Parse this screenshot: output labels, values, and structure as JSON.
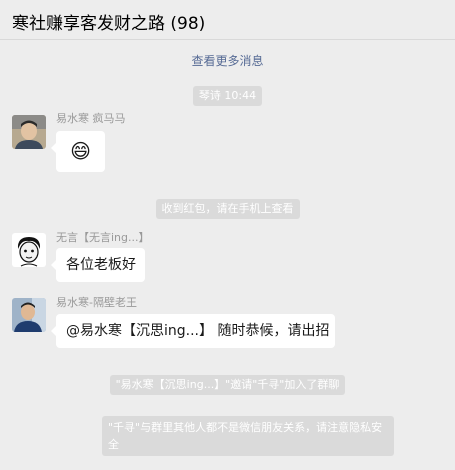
{
  "header": {
    "title": "寒社赚享客发财之路 (98)"
  },
  "more_link": "查看更多消息",
  "timestamp": "琴诗 10:44",
  "messages": [
    {
      "sender": "易水寒   疯马马",
      "content": "😄",
      "avatar_icon": "user-avatar-photo-icon"
    },
    {
      "sender": "无言【无言ing...】",
      "content": "各位老板好",
      "avatar_icon": "cartoon-face-avatar-icon"
    },
    {
      "sender": "易水寒-隔壁老王",
      "content": "@易水寒【沉思ing...】 随时恭候，请出招",
      "avatar_icon": "user-avatar-photo-icon"
    }
  ],
  "system": {
    "red_packet": "收到红包，请在手机上查看",
    "invite": "\"易水寒【沉思ing...】\"邀请\"千寻\"加入了群聊",
    "privacy": "\"千寻\"与群里其他人都不是微信朋友关系，请注意隐私安全"
  },
  "colors": {
    "background": "#ededed",
    "bubble": "#ffffff",
    "system_pill": "#dadada",
    "link": "#576b95"
  }
}
